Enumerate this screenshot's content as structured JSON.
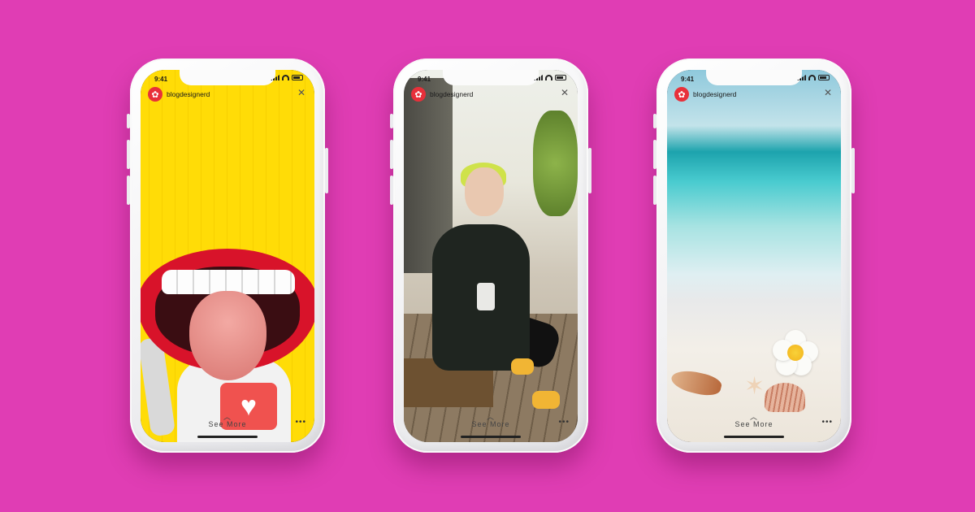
{
  "background_color": "#e03db4",
  "phones": [
    {
      "id": "story-yellow",
      "status_time": "9:41",
      "username": "blogdesignerd",
      "see_more": "See More",
      "close_icon": "close-icon",
      "more_icon": "more-dots-icon",
      "theme": "yellow"
    },
    {
      "id": "story-street",
      "status_time": "9:41",
      "username": "blogdesignerd",
      "see_more": "See More",
      "close_icon": "close-icon",
      "more_icon": "more-dots-icon",
      "theme": "street"
    },
    {
      "id": "story-beach",
      "status_time": "9:41",
      "username": "blogdesignerd",
      "see_more": "See More",
      "close_icon": "close-icon",
      "more_icon": "more-dots-icon",
      "theme": "beach"
    }
  ],
  "icons": {
    "close": "✕",
    "chevron_up": "︿",
    "more": "•••",
    "avatar": "✿",
    "heart": "♥",
    "starfish": "✶"
  }
}
